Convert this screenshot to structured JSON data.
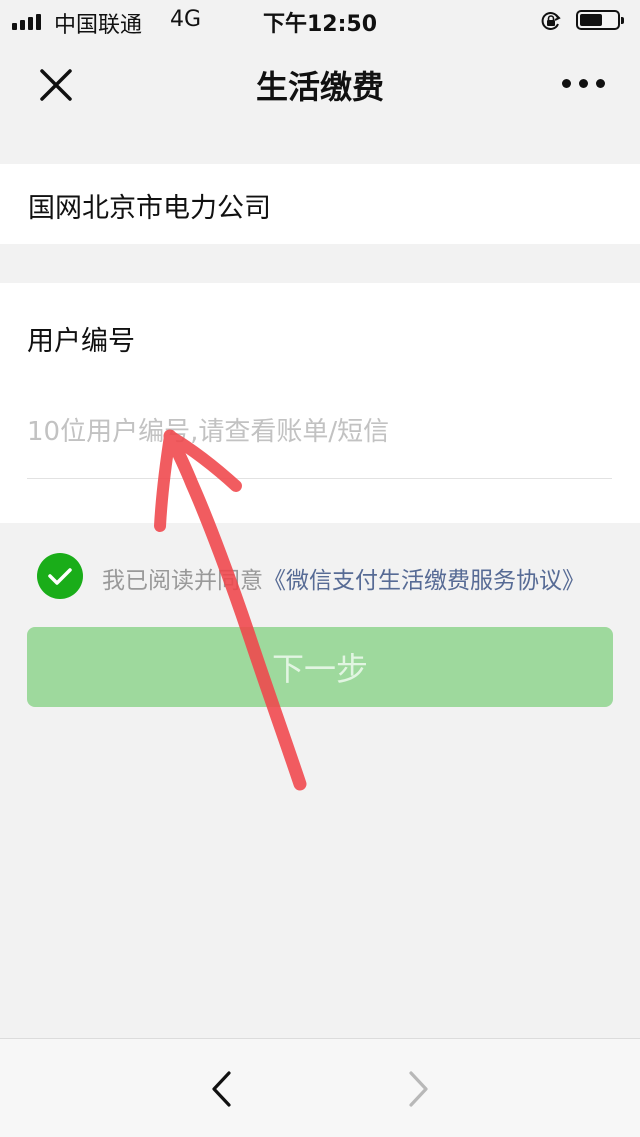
{
  "status_bar": {
    "carrier": "中国联通",
    "network": "4G",
    "time": "下午12:50"
  },
  "nav": {
    "title": "生活缴费",
    "close_icon": "close-icon",
    "more_icon": "more-icon"
  },
  "company": {
    "name": "国网北京市电力公司"
  },
  "account": {
    "label": "用户编号",
    "value": "",
    "placeholder": "10位用户编号,请查看账单/短信"
  },
  "agreement": {
    "checked": true,
    "prefix": "我已阅读并同意",
    "link": "《微信支付生活缴费服务协议》"
  },
  "next_button": {
    "label": "下一步",
    "enabled": false
  },
  "bottom_nav": {
    "back_icon": "chevron-left-icon",
    "forward_icon": "chevron-right-icon"
  },
  "colors": {
    "background": "#f2f2f2",
    "card": "#ffffff",
    "wechat_green": "#1aad19",
    "button_disabled": "#9ed99d",
    "link": "#576b95",
    "annotation": "#f0464b"
  }
}
